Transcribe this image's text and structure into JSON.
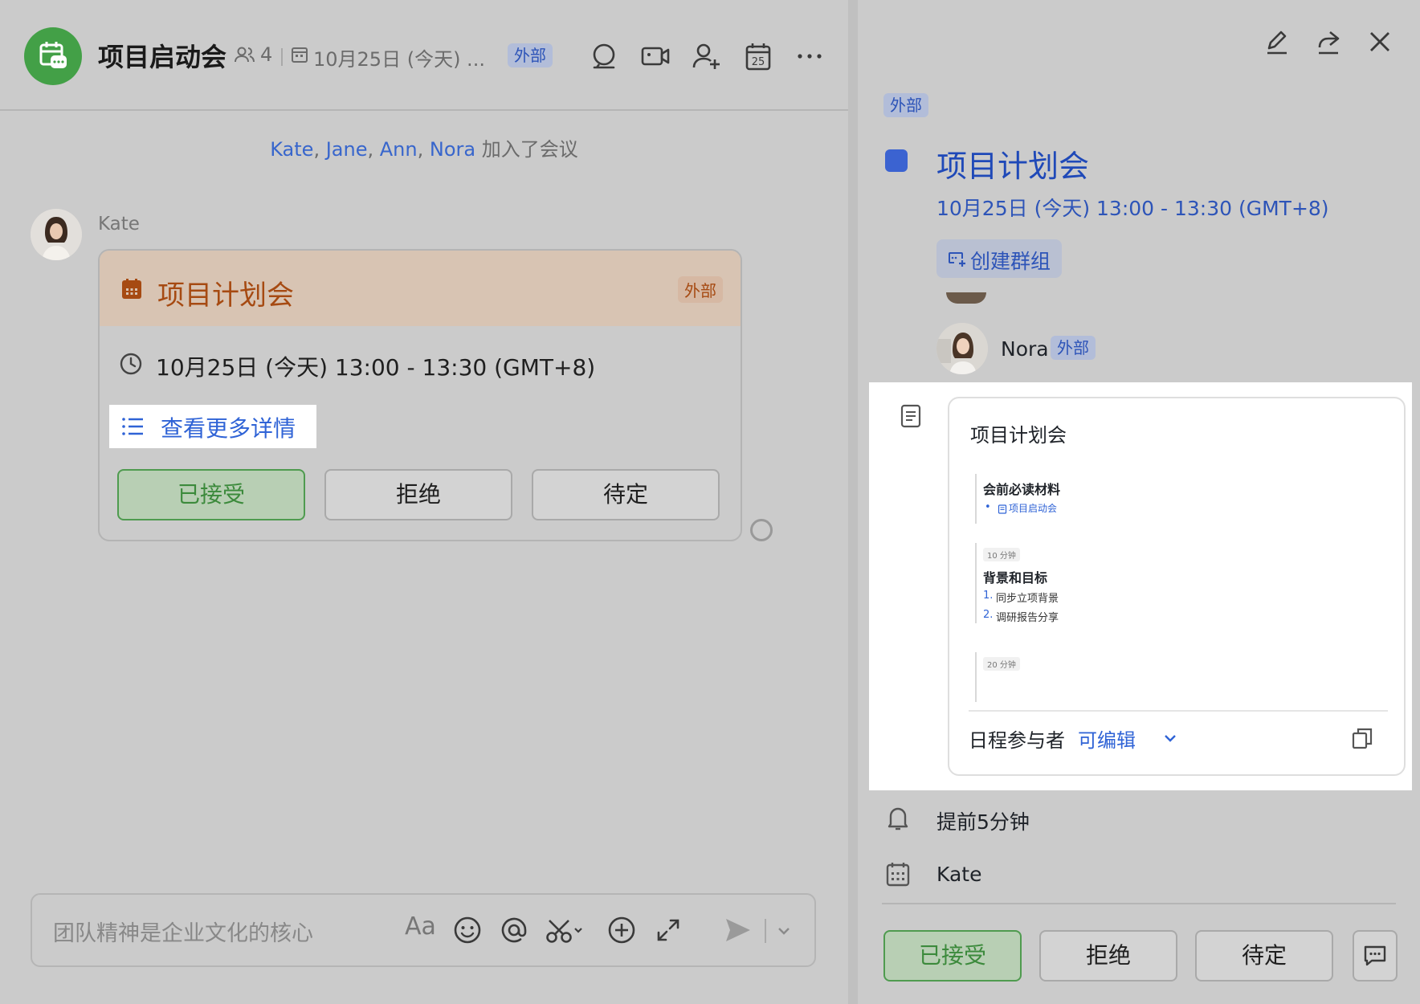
{
  "chat": {
    "title": "项目启动会",
    "member_count": "4",
    "event_preview": "10月25日 (今天) ...",
    "external_tag": "外部",
    "toolbar_icons": [
      "search-icon",
      "video-call-icon",
      "add-member-icon",
      "calendar-icon",
      "more-icon"
    ],
    "calendar_icon_day": "25",
    "join_notice": {
      "names": [
        "Kate",
        "Jane",
        "Ann",
        "Nora"
      ],
      "separator": ",",
      "suffix": "加入了会议"
    },
    "message": {
      "sender": "Kate",
      "card": {
        "title": "项目计划会",
        "external_tag": "外部",
        "time": "10月25日 (今天) 13:00 - 13:30 (GMT+8)",
        "details_link": "查看更多详情",
        "accept": "已接受",
        "decline": "拒绝",
        "tentative": "待定"
      }
    },
    "composer": {
      "placeholder": "团队精神是企业文化的核心",
      "format_label": "Aa"
    }
  },
  "event_detail": {
    "header_icons": [
      "edit-icon",
      "share-icon",
      "close-icon"
    ],
    "external_tag": "外部",
    "color": "#3b63d1",
    "title": "项目计划会",
    "time": "10月25日 (今天) 13:00 - 13:30 (GMT+8)",
    "create_group": "创建群组",
    "attendee": {
      "name": "Nora",
      "tag": "外部"
    },
    "doc": {
      "title": "项目计划会",
      "preview": {
        "section1_heading": "会前必读材料",
        "section1_item": "项目启动会",
        "chip1": "10 分钟",
        "section2_heading": "背景和目标",
        "items": [
          {
            "num": "1.",
            "text": "同步立项背景"
          },
          {
            "num": "2.",
            "text": "调研报告分享"
          }
        ],
        "chip2": "20 分钟"
      },
      "permission_label": "日程参与者",
      "permission_value": "可编辑"
    },
    "reminder": "提前5分钟",
    "organizer": "Kate",
    "accept": "已接受",
    "decline": "拒绝",
    "tentative": "待定"
  }
}
